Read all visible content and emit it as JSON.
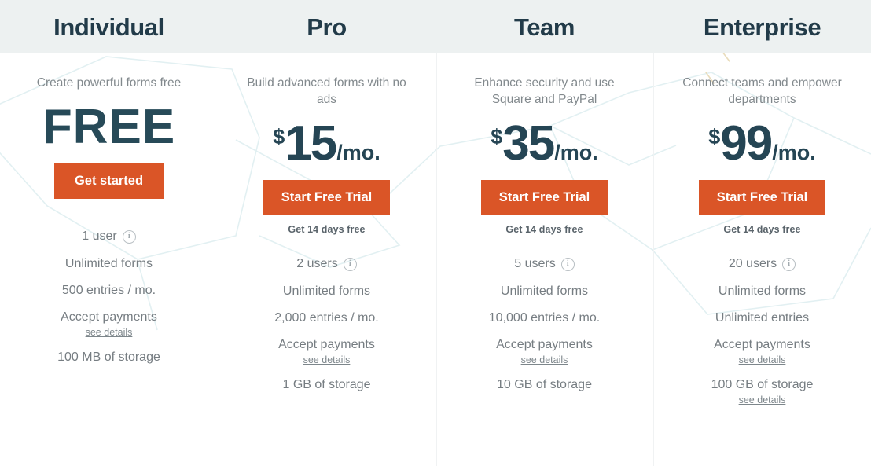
{
  "plans": [
    {
      "name": "Individual",
      "tagline": "Create powerful forms free",
      "price_free_label": "FREE",
      "cta_label": "Get started",
      "cta_note": "",
      "features": {
        "users": "1 user",
        "forms": "Unlimited forms",
        "entries": "500 entries / mo.",
        "payments": "Accept payments",
        "payments_details": "see details",
        "storage": "100 MB of storage",
        "storage_details": ""
      }
    },
    {
      "name": "Pro",
      "tagline": "Build advanced forms with no ads",
      "currency": "$",
      "amount": "15",
      "period": "/mo.",
      "cta_label": "Start Free Trial",
      "cta_note": "Get 14 days free",
      "features": {
        "users": "2 users",
        "forms": "Unlimited forms",
        "entries": "2,000 entries / mo.",
        "payments": "Accept payments",
        "payments_details": "see details",
        "storage": "1 GB of storage",
        "storage_details": ""
      }
    },
    {
      "name": "Team",
      "tagline": "Enhance security and use Square and PayPal",
      "currency": "$",
      "amount": "35",
      "period": "/mo.",
      "cta_label": "Start Free Trial",
      "cta_note": "Get 14 days free",
      "features": {
        "users": "5 users",
        "forms": "Unlimited forms",
        "entries": "10,000 entries / mo.",
        "payments": "Accept payments",
        "payments_details": "see details",
        "storage": "10 GB of storage",
        "storage_details": ""
      }
    },
    {
      "name": "Enterprise",
      "tagline": "Connect teams and empower departments",
      "currency": "$",
      "amount": "99",
      "period": "/mo.",
      "cta_label": "Start Free Trial",
      "cta_note": "Get 14 days free",
      "features": {
        "users": "20 users",
        "forms": "Unlimited forms",
        "entries": "Unlimited entries",
        "payments": "Accept payments",
        "payments_details": "see details",
        "storage": "100 GB of storage",
        "storage_details": "see details"
      }
    }
  ],
  "icons": {
    "info": "i"
  },
  "colors": {
    "accent_orange": "#da5527",
    "heading_navy": "#223b49",
    "price_navy": "#254554",
    "header_band": "#edf1f1",
    "body_text": "#767d82",
    "decor_teal": "#e4f2f3",
    "decor_tan": "#e7d9b7"
  }
}
